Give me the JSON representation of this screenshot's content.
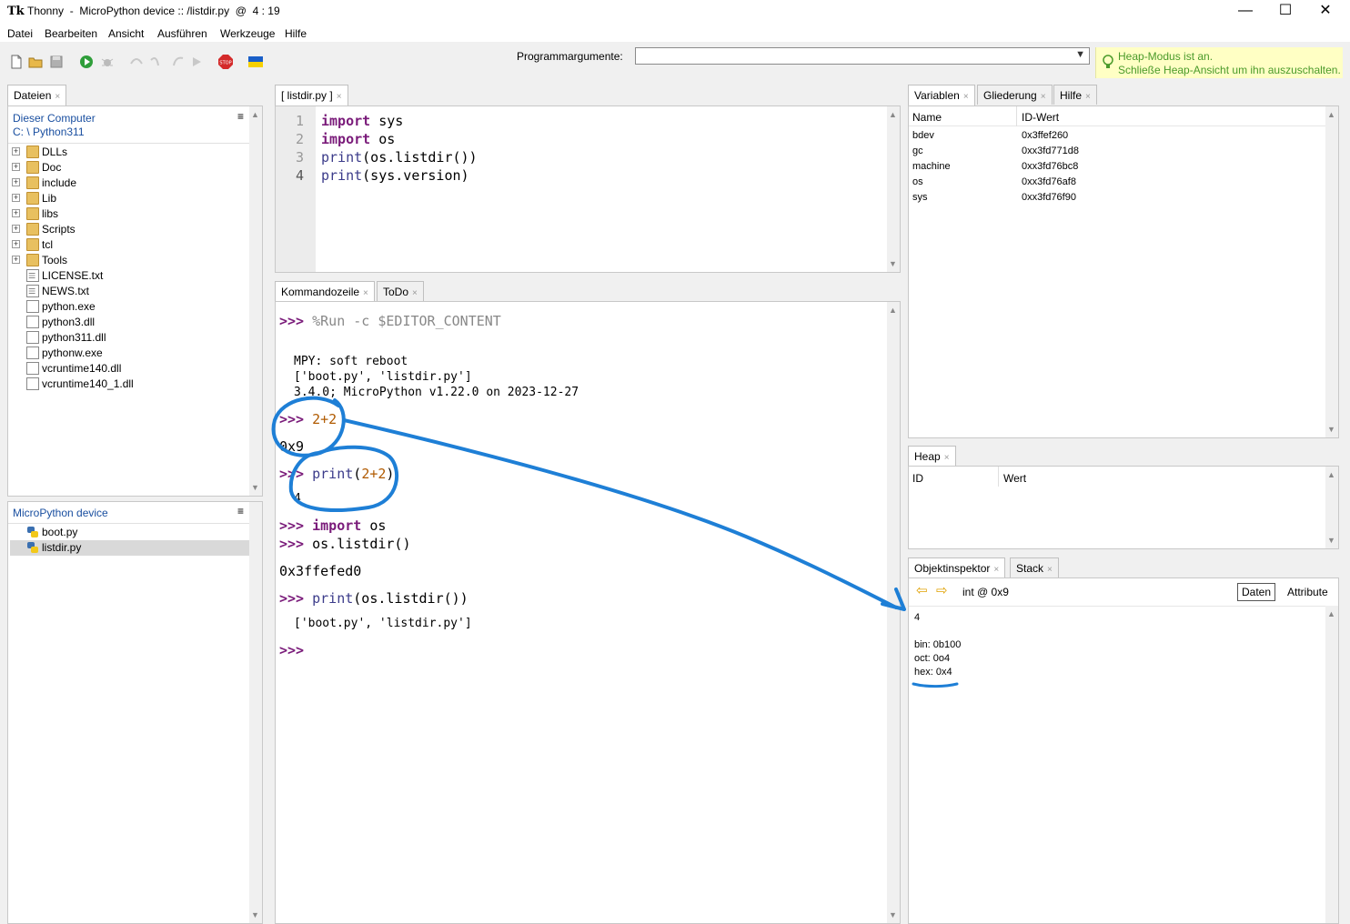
{
  "window": {
    "title": "Thonny  -  MicroPython device :: /listdir.py  @  4 : 19",
    "minimize": "—",
    "maximize": "☐",
    "close": "✕"
  },
  "menu": [
    "Datei",
    "Bearbeiten",
    "Ansicht",
    "Ausführen",
    "Werkzeuge",
    "Hilfe"
  ],
  "toolbar": {
    "icons": [
      "new-file-icon",
      "open-file-icon",
      "save-icon",
      "run-icon",
      "debug-icon",
      "step-over-icon",
      "step-into-icon",
      "step-out-icon",
      "resume-icon",
      "stop-icon",
      "flag-icon"
    ],
    "program_args_label": "Programmargumente:",
    "program_args_value": "",
    "heap_note_line1": "Heap-Modus ist an.",
    "heap_note_line2": "Schließe Heap-Ansicht um ihn auszuschalten."
  },
  "files": {
    "tab": "Dateien",
    "computer_header": "Dieser Computer",
    "computer_path": "C: \\ Python311",
    "computer_items": [
      {
        "name": "DLLs",
        "type": "folder"
      },
      {
        "name": "Doc",
        "type": "folder"
      },
      {
        "name": "include",
        "type": "folder"
      },
      {
        "name": "Lib",
        "type": "folder"
      },
      {
        "name": "libs",
        "type": "folder"
      },
      {
        "name": "Scripts",
        "type": "folder"
      },
      {
        "name": "tcl",
        "type": "folder"
      },
      {
        "name": "Tools",
        "type": "folder"
      },
      {
        "name": "LICENSE.txt",
        "type": "text"
      },
      {
        "name": "NEWS.txt",
        "type": "text"
      },
      {
        "name": "python.exe",
        "type": "file"
      },
      {
        "name": "python3.dll",
        "type": "file"
      },
      {
        "name": "python311.dll",
        "type": "file"
      },
      {
        "name": "pythonw.exe",
        "type": "file"
      },
      {
        "name": "vcruntime140.dll",
        "type": "file"
      },
      {
        "name": "vcruntime140_1.dll",
        "type": "file"
      }
    ],
    "device_header": "MicroPython device",
    "device_items": [
      {
        "name": "boot.py",
        "type": "python"
      },
      {
        "name": "listdir.py",
        "type": "python",
        "selected": true
      }
    ]
  },
  "editor": {
    "tab": "[ listdir.py ]",
    "line_numbers": [
      "1",
      "2",
      "3",
      "4"
    ]
  },
  "shell": {
    "tabs": [
      "Kommandozeile",
      "ToDo"
    ],
    "run_cmd": "%Run -c $EDITOR_CONTENT",
    "reboot": "MPY: soft reboot",
    "listdir_out1": "['boot.py', 'listdir.py']",
    "version_out": "3.4.0; MicroPython v1.22.0 on 2023-12-27",
    "out_0x9": "0x9",
    "out_4": "4",
    "out_addr": "0x3ffefed0",
    "listdir_out2": "['boot.py', 'listdir.py']",
    "prompt": ">>>"
  },
  "variables": {
    "tabs": [
      "Variablen",
      "Gliederung",
      "Hilfe"
    ],
    "col_name": "Name",
    "col_value": "ID-Wert",
    "rows": [
      {
        "name": "bdev",
        "value": "0x3ffef260"
      },
      {
        "name": "gc",
        "value": "0xx3fd771d8"
      },
      {
        "name": "machine",
        "value": "0xx3fd76bc8"
      },
      {
        "name": "os",
        "value": "0xx3fd76af8"
      },
      {
        "name": "sys",
        "value": "0xx3fd76f90"
      }
    ]
  },
  "heap": {
    "tab": "Heap",
    "col_id": "ID",
    "col_value": "Wert"
  },
  "inspector": {
    "tabs": [
      "Objektinspektor",
      "Stack"
    ],
    "object": "int @ 0x9",
    "btn_data": "Daten",
    "btn_attr": "Attribute",
    "value": "4",
    "bin": "bin: 0b100",
    "oct": "oct: 0o4",
    "hex": "hex: 0x4"
  },
  "colors": {
    "annotation": "#1e7fd6",
    "keyword": "#7a1b7a",
    "heap_note_bg": "#ffffc4",
    "heap_note_text": "#4a9a2a"
  }
}
